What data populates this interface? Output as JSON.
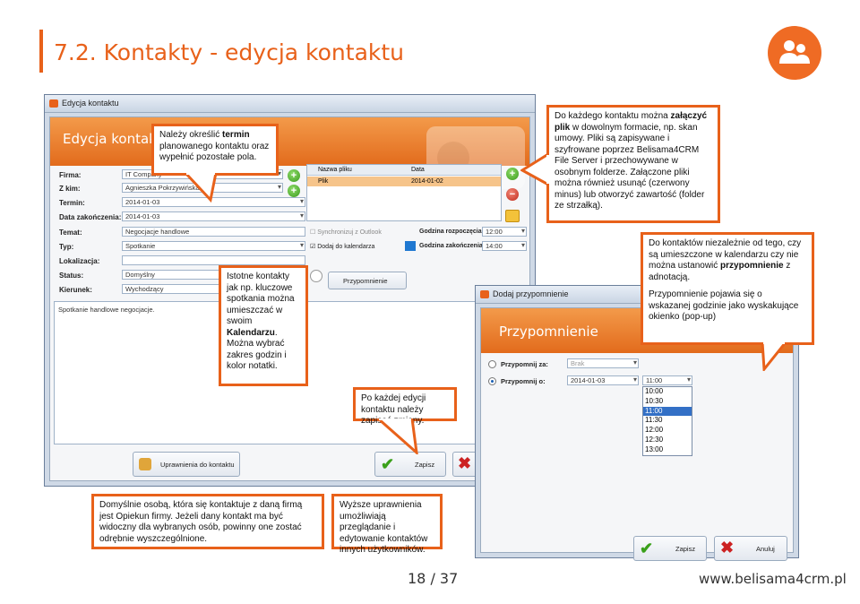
{
  "slide": {
    "title": "7.2. Kontakty - edycja kontaktu",
    "page_number": "18 / 37",
    "footer_url": "www.belisama4crm.pl",
    "accent_color": "#e8611a",
    "logo_icon": "people-icon"
  },
  "main_window": {
    "window_title": "Edycja kontaktu",
    "header": "Edycja kontaktu",
    "fields": {
      "firma_label": "Firma:",
      "firma_value": "IT Company",
      "zkim_label": "Z kim:",
      "zkim_value": "Agnieszka Pokrzywińska",
      "termin_label": "Termin:",
      "termin_value": "2014-01-03",
      "data_zak_label": "Data zakończenia:",
      "data_zak_value": "2014-01-03",
      "temat_label": "Temat:",
      "temat_value": "Negocjacje handlowe",
      "typ_label": "Typ:",
      "typ_value": "Spotkanie",
      "lokalizacja_label": "Lokalizacja:",
      "lokalizacja_value": "",
      "status_label": "Status:",
      "status_value": "Domyślny",
      "kierunek_label": "Kierunek:",
      "kierunek_value": "Wychodzący"
    },
    "notes": "Spotkanie handlowe negocjacje.",
    "files_table": {
      "columns": [
        "Nazwa pliku",
        "Data"
      ],
      "rows": [
        [
          "Plik",
          "2014-01-02"
        ]
      ]
    },
    "sync_outlook": "Synchronizuj z Outlook",
    "add_to_calendar": "Dodaj do kalendarza",
    "start_label": "Godzina rozpoczęcia:",
    "start_value": "12:00",
    "end_label": "Godzina zakończenia:",
    "end_value": "14:00",
    "reminder_button": "Przypomnienie",
    "permissions_button": "Uprawnienia do kontaktu",
    "save_button": "Zapisz"
  },
  "reminder_dialog": {
    "window_title": "Dodaj przypomnienie",
    "header": "Przypomnienie",
    "option_za_label": "Przypomnij za:",
    "option_za_value": "Brak",
    "option_o_label": "Przypomnij o:",
    "option_o_date": "2014-01-03",
    "option_o_time": "11:00",
    "time_options": [
      "10:00",
      "10:30",
      "11:00",
      "11:30",
      "12:00",
      "12:30",
      "13:00"
    ],
    "selected_time": "11:00",
    "save_button": "Zapisz",
    "cancel_button": "Anuluj"
  },
  "callouts": {
    "c1_pre": "Należy określić ",
    "c1_bold": "termin",
    "c1_post": " planowanego kontaktu oraz wypełnić pozostałe pola.",
    "c2_pre": "Do każdego kontaktu można ",
    "c2_bold": "załączyć plik",
    "c2_post": " w dowolnym formacie, np. skan umowy. Pliki są zapisywane i szyfrowane poprzez Belisama4CRM File Server i przechowywane w osobnym folderze. Załączone pliki można również usunąć (czerwony minus) lub otworzyć zawartość (folder ze strzałką).",
    "c3_pre": "Istotne kontakty jak np. kluczowe spotkania można umieszczać w swoim ",
    "c3_bold": "Kalendarzu",
    "c3_post": ". Można wybrać zakres godzin i kolor notatki.",
    "c4_a_pre": "Do kontaktów niezależnie od tego, czy są umieszczone w kalendarzu czy nie można ustanowić ",
    "c4_a_bold": "przypomnienie",
    "c4_a_post": " z adnotacją.",
    "c4_b": "Przypomnienie pojawia się o wskazanej godzinie jako wyskakujące okienko (pop-up)",
    "c5": "Po każdej edycji kontaktu należy zapisać zmiany.",
    "c6": "Domyślnie osobą, która się kontaktuje z daną firmą jest Opiekun firmy. Jeżeli dany kontakt ma być widoczny dla wybranych osób, powinny one zostać odrębnie wyszczególnione.",
    "c7": "Wyższe uprawnienia umożliwiają przeglądanie i edytowanie kontaktów innych użytkowników."
  }
}
